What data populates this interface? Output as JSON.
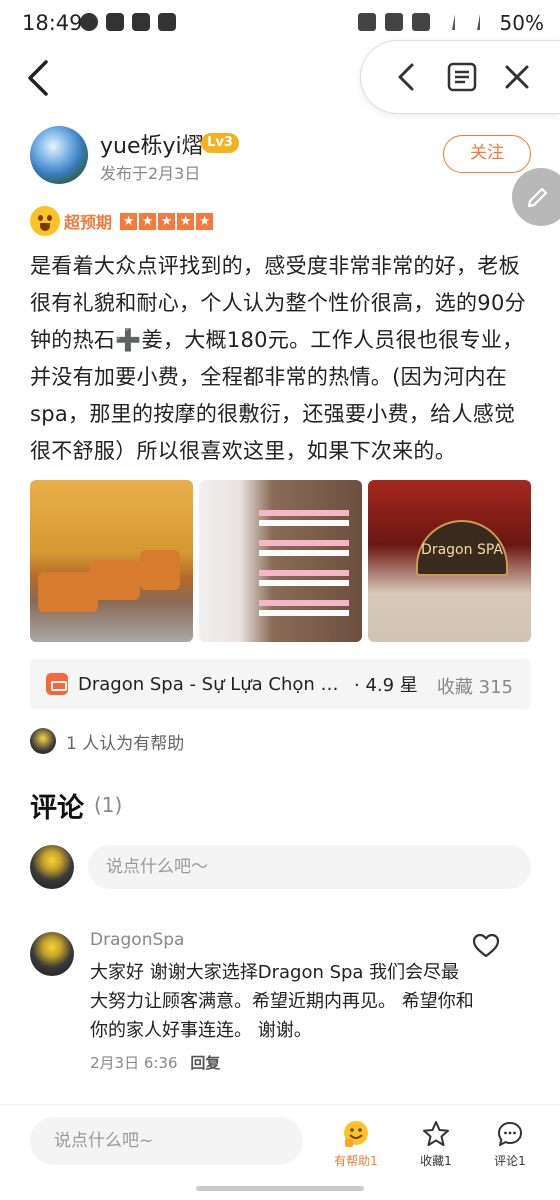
{
  "status_bar": {
    "time": "18:49",
    "battery": "50%"
  },
  "author": {
    "name": "yue栎yi熠",
    "level": "Lv3",
    "publish_date": "发布于2月3日",
    "follow_label": "关注"
  },
  "rating": {
    "label": "超预期",
    "stars": 5,
    "star_glyph": "★"
  },
  "review": {
    "text": "是看着大众点评找到的，感受度非常非常的好，老板很有礼貌和耐心，个人认为整个性价很高，选的90分钟的热石➕姜，大概180元。工作人员很也很专业，并没有加要小费，全程都非常的热情。(因为河内在spa，那里的按摩的很敷衍，还强要小费，给人感觉很不舒服）所以很喜欢这里，如果下次来的。"
  },
  "photos": {
    "logo_text": "Dragon SPA"
  },
  "shop": {
    "name": "Dragon Spa - Sự Lựa Chọn Hoàn Hảo",
    "rating": "· 4.9 星",
    "favorites": "收藏 315"
  },
  "helpful": {
    "text": "1 人认为有帮助"
  },
  "comments": {
    "title": "评论",
    "count": "(1)",
    "input_placeholder": "说点什么吧～",
    "items": [
      {
        "author": "DragonSpa",
        "text": "大家好 谢谢大家选择Dragon Spa 我们会尽最大努力让顾客满意。希望近期内再见。 希望你和你的家人好事连连。 谢谢。",
        "date": "2月3日  6:36",
        "reply_label": "回复"
      }
    ]
  },
  "bottom_bar": {
    "input_placeholder": "说点什么吧~",
    "helpful_label": "有帮助1",
    "favorite_label": "收藏1",
    "comment_label": "评论1"
  },
  "colors": {
    "accent": "#f47a3c",
    "level_badge": "#f5b21f"
  }
}
